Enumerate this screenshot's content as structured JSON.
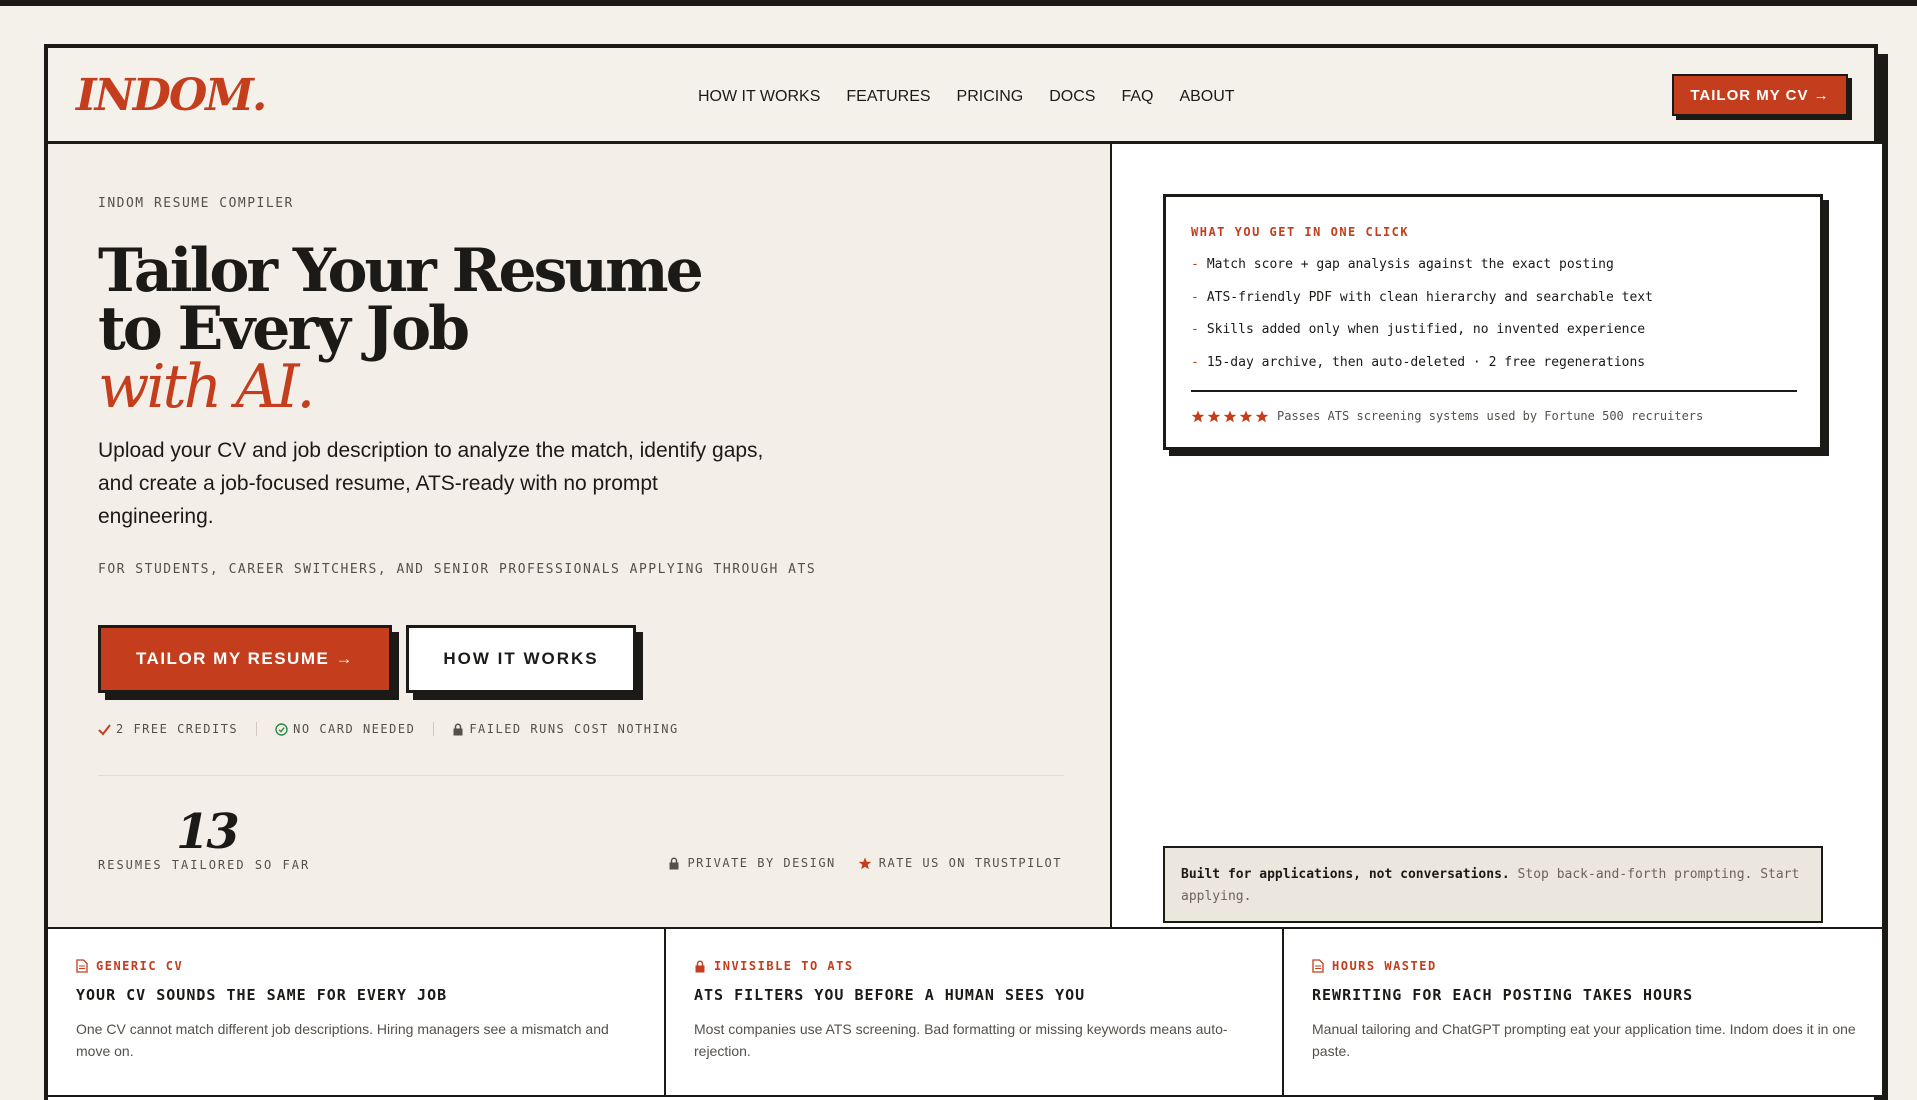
{
  "brand": {
    "logo": "INDOM.",
    "accent_color": "#c43d1c",
    "ink_color": "#1c1a17",
    "paper_color": "#f4f1eb"
  },
  "nav": {
    "items": [
      "HOW IT WORKS",
      "FEATURES",
      "PRICING",
      "DOCS",
      "FAQ",
      "ABOUT"
    ],
    "cta": "TAILOR MY CV →"
  },
  "hero": {
    "eyebrow": "INDOM RESUME COMPILER",
    "headline_line1": "Tailor Your Resume",
    "headline_line2": "to Every Job",
    "headline_line3": "with AI.",
    "lede": "Upload your CV and job description to analyze the match, identify gaps, and create a job-focused resume, ATS-ready with no prompt engineering.",
    "audience": "FOR STUDENTS, CAREER SWITCHERS, AND SENIOR PROFESSIONALS APPLYING THROUGH ATS",
    "primary_cta": "TAILOR MY RESUME →",
    "secondary_cta": "HOW IT WORKS",
    "perks": [
      {
        "icon": "check-icon",
        "label": "2 FREE CREDITS"
      },
      {
        "icon": "check-circle-icon",
        "label": "NO CARD NEEDED"
      },
      {
        "icon": "lock-icon",
        "label": "FAILED RUNS COST NOTHING"
      }
    ],
    "counter_value": "13",
    "counter_label": "RESUMES TAILORED SO FAR",
    "trust": [
      {
        "icon": "lock-icon",
        "label": "PRIVATE BY DESIGN"
      },
      {
        "icon": "star-icon",
        "label": "RATE US ON TRUSTPILOT"
      }
    ]
  },
  "card": {
    "title": "WHAT YOU GET IN ONE CLICK",
    "items": [
      "Match score + gap analysis against the exact posting",
      "ATS-friendly PDF with clean hierarchy and searchable text",
      "Skills added only when justified, no invented experience",
      "15-day archive, then auto-deleted · 2 free regenerations"
    ],
    "rating_stars": 5,
    "footer": "Passes ATS screening systems used by Fortune 500 recruiters"
  },
  "note": {
    "bold": "Built for applications, not conversations.",
    "text": " Stop back-and-forth prompting. Start applying."
  },
  "features": [
    {
      "icon": "document-icon",
      "tag": "GENERIC CV",
      "title": "YOUR CV SOUNDS THE SAME FOR EVERY JOB",
      "text": "One CV cannot match different job descriptions. Hiring managers see a mismatch and move on."
    },
    {
      "icon": "lock-icon",
      "tag": "INVISIBLE TO ATS",
      "title": "ATS FILTERS YOU BEFORE A HUMAN SEES YOU",
      "text": "Most companies use ATS screening. Bad formatting or missing keywords means auto-rejection."
    },
    {
      "icon": "document-icon",
      "tag": "HOURS WASTED",
      "title": "REWRITING FOR EACH POSTING TAKES HOURS",
      "text": "Manual tailoring and ChatGPT prompting eat your application time. Indom does it in one paste."
    }
  ]
}
